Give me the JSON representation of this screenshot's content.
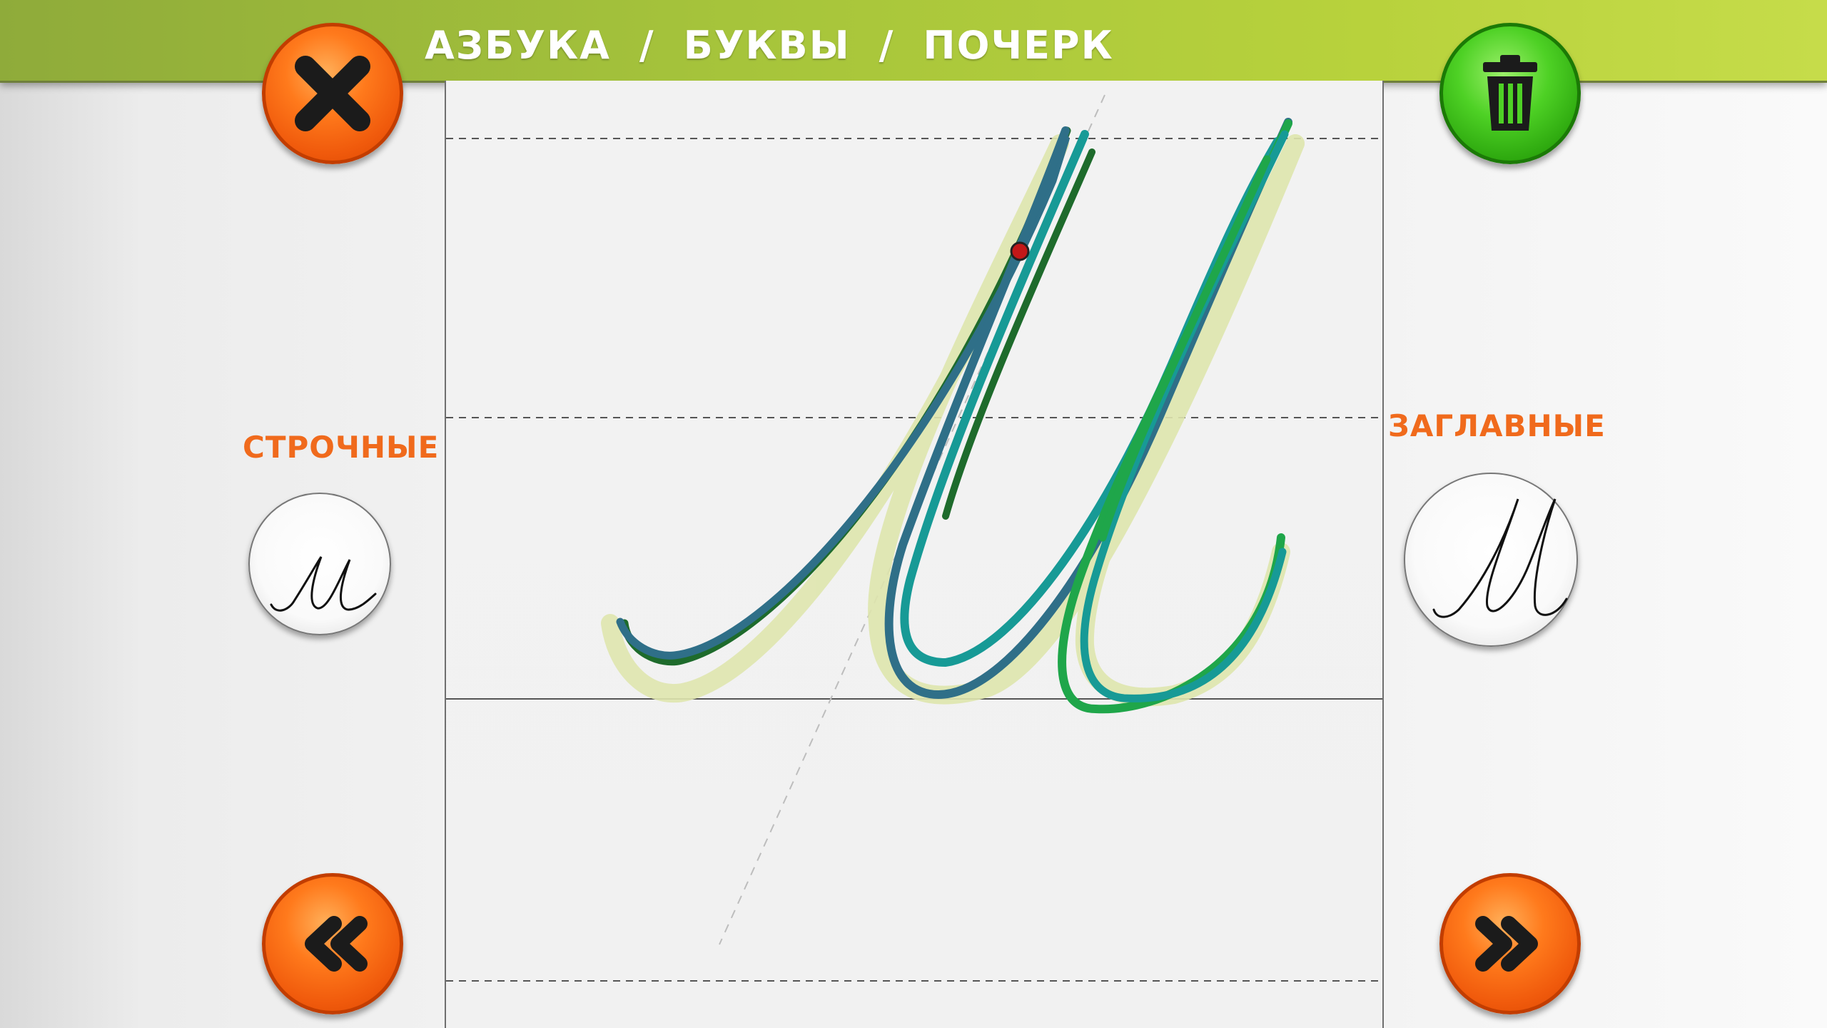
{
  "header": {
    "breadcrumb": [
      "АЗБУКА",
      "/",
      "БУКВЫ",
      "/",
      "ПОЧЕРК"
    ]
  },
  "toolbar": {
    "close_icon": "close-x-icon",
    "delete_icon": "trash-icon",
    "prev_icon": "double-chevron-left-icon",
    "next_icon": "double-chevron-right-icon"
  },
  "left_panel": {
    "label": "СТРОЧНЫЕ",
    "sample_letter": "м"
  },
  "right_panel": {
    "label": "ЗАГЛАВНЫЕ",
    "sample_letter": "М"
  },
  "canvas": {
    "current_letter": "М"
  },
  "colors": {
    "bar_green": "#a6c43b",
    "button_orange": "#f05a0c",
    "button_green": "#2ea90f",
    "label_orange": "#f06a1c",
    "stroke_dark_green": "#1e6b2c",
    "stroke_blue_teal": "#2f6f88",
    "stroke_teal": "#179a96",
    "stroke_green": "#1fa64a",
    "guide_fill": "#dfe6ae",
    "pen_marker": "#c21818"
  }
}
